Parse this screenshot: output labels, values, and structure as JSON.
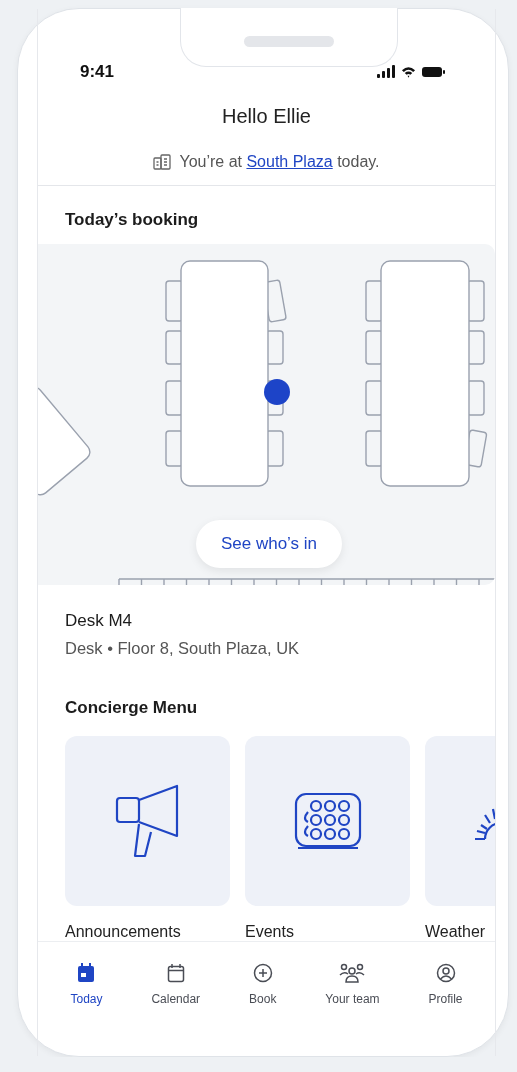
{
  "status_bar": {
    "time": "9:41"
  },
  "header": {
    "title": "Hello Ellie",
    "location_prefix": "You’re at",
    "location_link": "South Plaza",
    "location_suffix": "today."
  },
  "booking": {
    "heading": "Today’s booking",
    "button": "See who’s in",
    "desk": "Desk M4",
    "details": "Desk • Floor 8, South Plaza, UK"
  },
  "concierge": {
    "heading": "Concierge Menu",
    "items": [
      {
        "label": "Announcements",
        "kind": "megaphone"
      },
      {
        "label": "Events",
        "kind": "events"
      },
      {
        "label": "Weather",
        "kind": "weather"
      }
    ]
  },
  "tabs": [
    {
      "label": "Today",
      "kind": "today",
      "selected": true
    },
    {
      "label": "Calendar",
      "kind": "calendar",
      "selected": false
    },
    {
      "label": "Book",
      "kind": "book",
      "selected": false
    },
    {
      "label": "Your team",
      "kind": "team",
      "selected": false
    },
    {
      "label": "Profile",
      "kind": "profile",
      "selected": false
    }
  ]
}
